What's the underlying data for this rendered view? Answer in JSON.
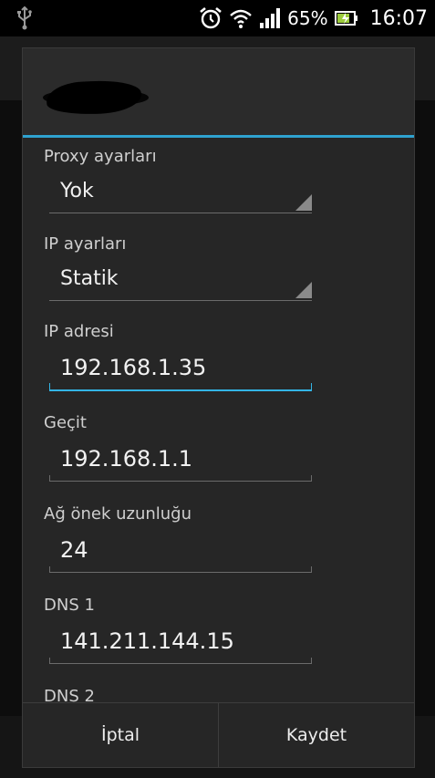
{
  "status_bar": {
    "icons": [
      "usb-icon",
      "alarm-icon",
      "wifi-icon",
      "signal-icon",
      "battery-icon"
    ],
    "battery_percent": "65%",
    "time": "16:07"
  },
  "dialog": {
    "title": "",
    "accent_color": "#33b5e5",
    "fields": {
      "proxy": {
        "label": "Proxy ayarları",
        "value": "Yok"
      },
      "ip_settings": {
        "label": "IP ayarları",
        "value": "Statik"
      },
      "ip_address": {
        "label": "IP adresi",
        "value": "192.168.1.35"
      },
      "gateway": {
        "label": "Geçit",
        "value": "192.168.1.1"
      },
      "prefix_length": {
        "label": "Ağ önek uzunluğu",
        "value": "24"
      },
      "dns1": {
        "label": "DNS 1",
        "value": "141.211.144.15"
      },
      "dns2": {
        "label": "DNS 2"
      }
    },
    "buttons": {
      "cancel": "İptal",
      "save": "Kaydet"
    }
  }
}
